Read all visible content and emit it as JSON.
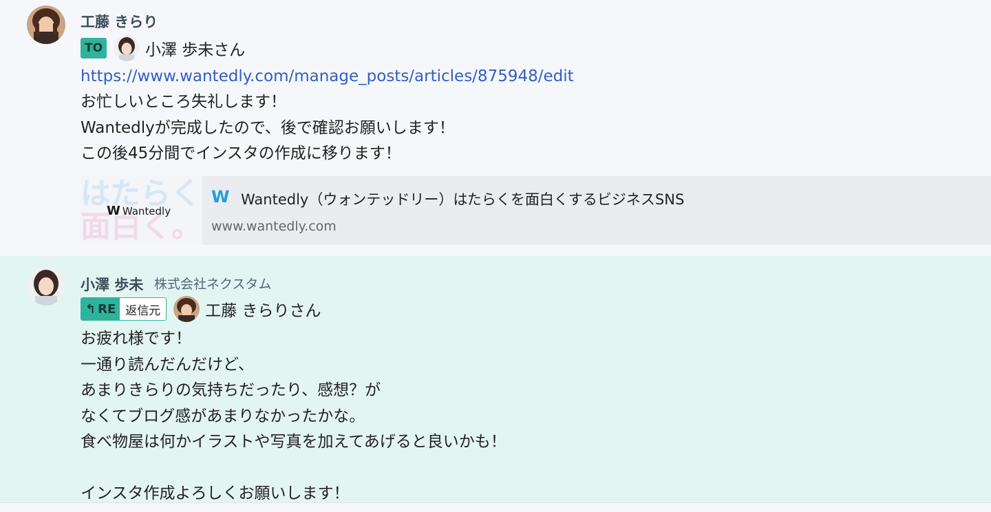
{
  "messages": [
    {
      "sender": "工藤 きらり",
      "to_badge": "TO",
      "to_name": "小澤 歩未さん",
      "link": "https://www.wantedly.com/manage_posts/articles/875948/edit",
      "lines": [
        "お忙しいところ失礼します！",
        "Wantedlyが完成したので、後で確認お願いします！",
        "この後45分間でインスタの作成に移ります！"
      ],
      "preview": {
        "thumb_text_1": "はたらくを",
        "thumb_text_2": "面白く。",
        "thumb_logo": "Wantedly",
        "title": "Wantedly（ウォンテッドリー）はたらくを面白くするビジネスSNS",
        "url": "www.wantedly.com"
      }
    },
    {
      "sender": "小澤 歩未",
      "org": "株式会社ネクスタム",
      "re_badge": "RE",
      "re_source": "返信元",
      "reply_to_name": "工藤 きらりさん",
      "lines": [
        "お疲れ様です！",
        "一通り読んだんだけど、",
        "あまりきらりの気持ちだったり、感想？が",
        "なくてブログ感があまりなかったかな。",
        "食べ物屋は何かイラストや写真を加えてあげると良いかも！",
        "",
        "インスタ作成よろしくお願いします！"
      ]
    }
  ],
  "colors": {
    "accent": "#2fb39c",
    "link": "#2f5fc4",
    "reply_bg": "#e3f5f2",
    "page_bg": "#f6f7fa"
  }
}
